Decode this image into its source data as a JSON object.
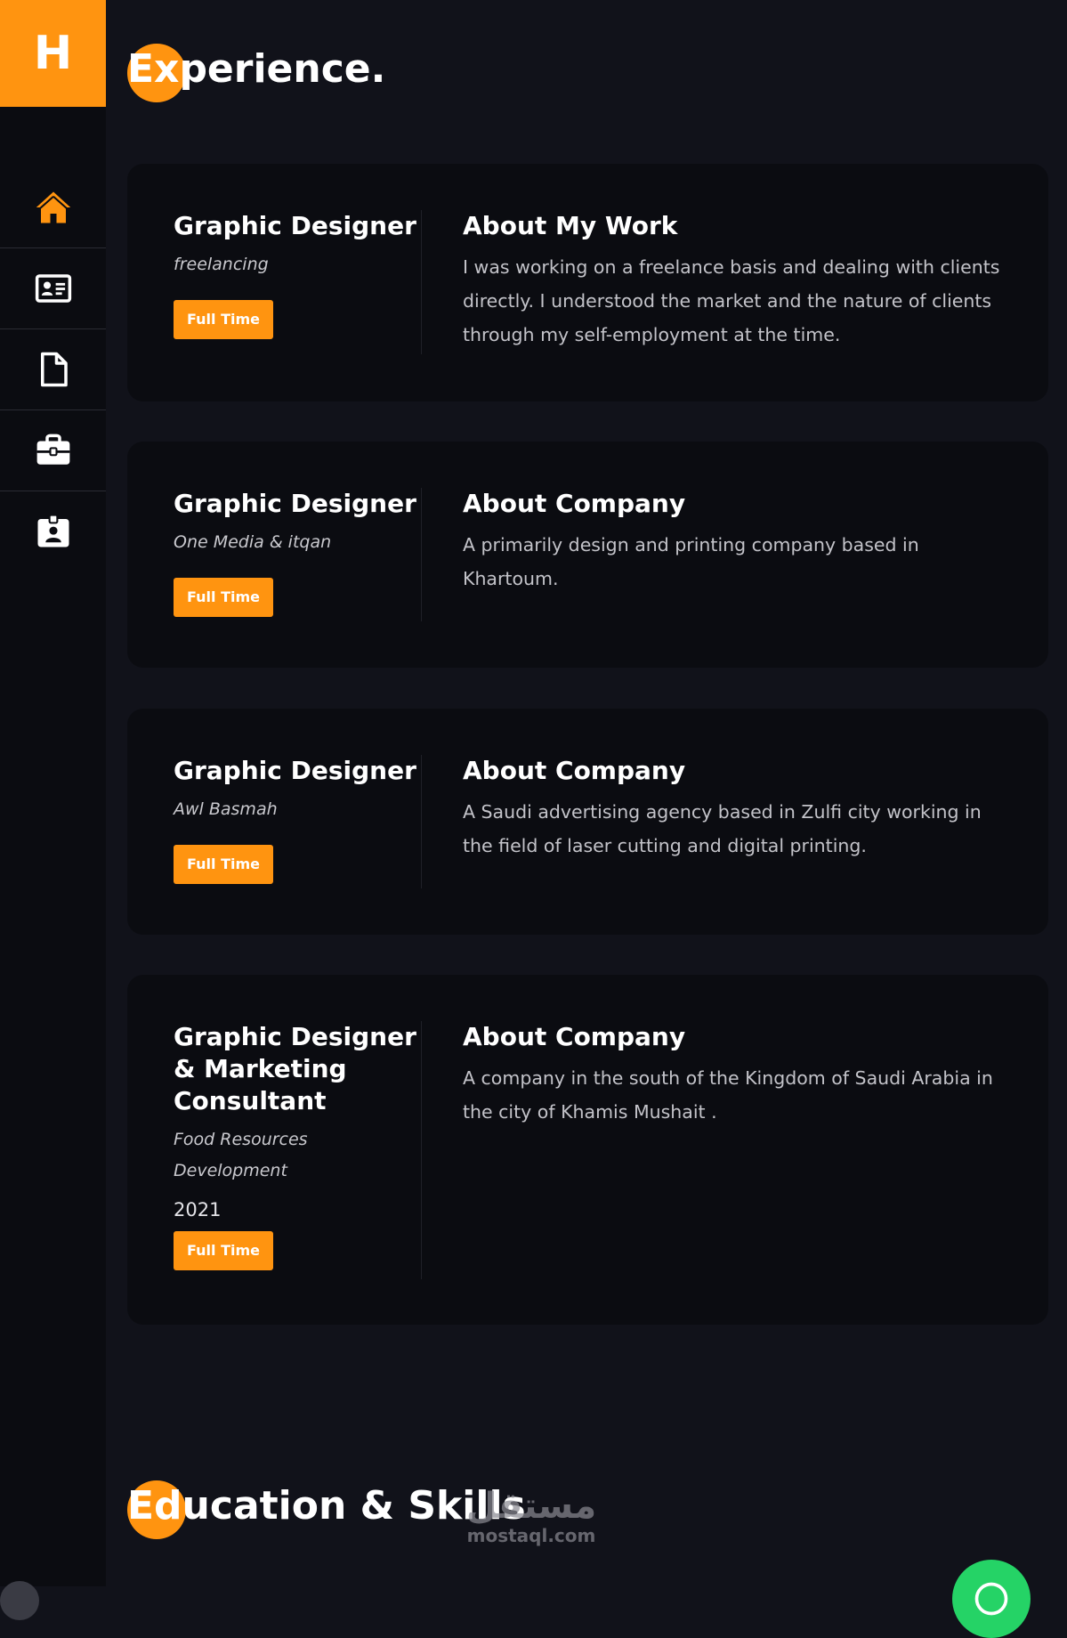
{
  "logo": {
    "letter": "H"
  },
  "nav": {
    "items": [
      {
        "icon": "home-icon",
        "active": true
      },
      {
        "icon": "id-card-icon",
        "active": false
      },
      {
        "icon": "document-icon",
        "active": false
      },
      {
        "icon": "briefcase-icon",
        "active": false
      },
      {
        "icon": "badge-icon",
        "active": false
      }
    ]
  },
  "experience": {
    "title": "Experience.",
    "jobs": [
      {
        "title": "Graphic Designer",
        "company": "freelancing",
        "year": "",
        "type": "Full Time",
        "about_title": "About My Work",
        "about_text": "I was working on a freelance basis and dealing with clients directly. I understood the market and the nature of clients through my self-employment at the time."
      },
      {
        "title": "Graphic Designer",
        "company": "One Media & itqan",
        "year": "",
        "type": "Full Time",
        "about_title": "About Company",
        "about_text": "A primarily design and printing company based in Khartoum."
      },
      {
        "title": "Graphic Designer",
        "company": "Awl Basmah",
        "year": "",
        "type": "Full Time",
        "about_title": "About Company",
        "about_text": "A Saudi advertising agency based in Zulfi city working in the field of laser cutting and digital printing."
      },
      {
        "title": "Graphic Designer & Marketing Consultant",
        "company": "Food Resources Development",
        "year": "2021",
        "type": "Full Time",
        "about_title": "About Company",
        "about_text": "A company in the south of the Kingdom of Saudi Arabia in the city of Khamis Mushait ."
      }
    ]
  },
  "education": {
    "title": "Education & Skills"
  },
  "watermark": {
    "arabic": "مستقل",
    "latin": "mostaql.com"
  },
  "colors": {
    "accent": "#ff9410",
    "background": "#11121a",
    "card": "#0b0c11",
    "whatsapp": "#25d366"
  }
}
